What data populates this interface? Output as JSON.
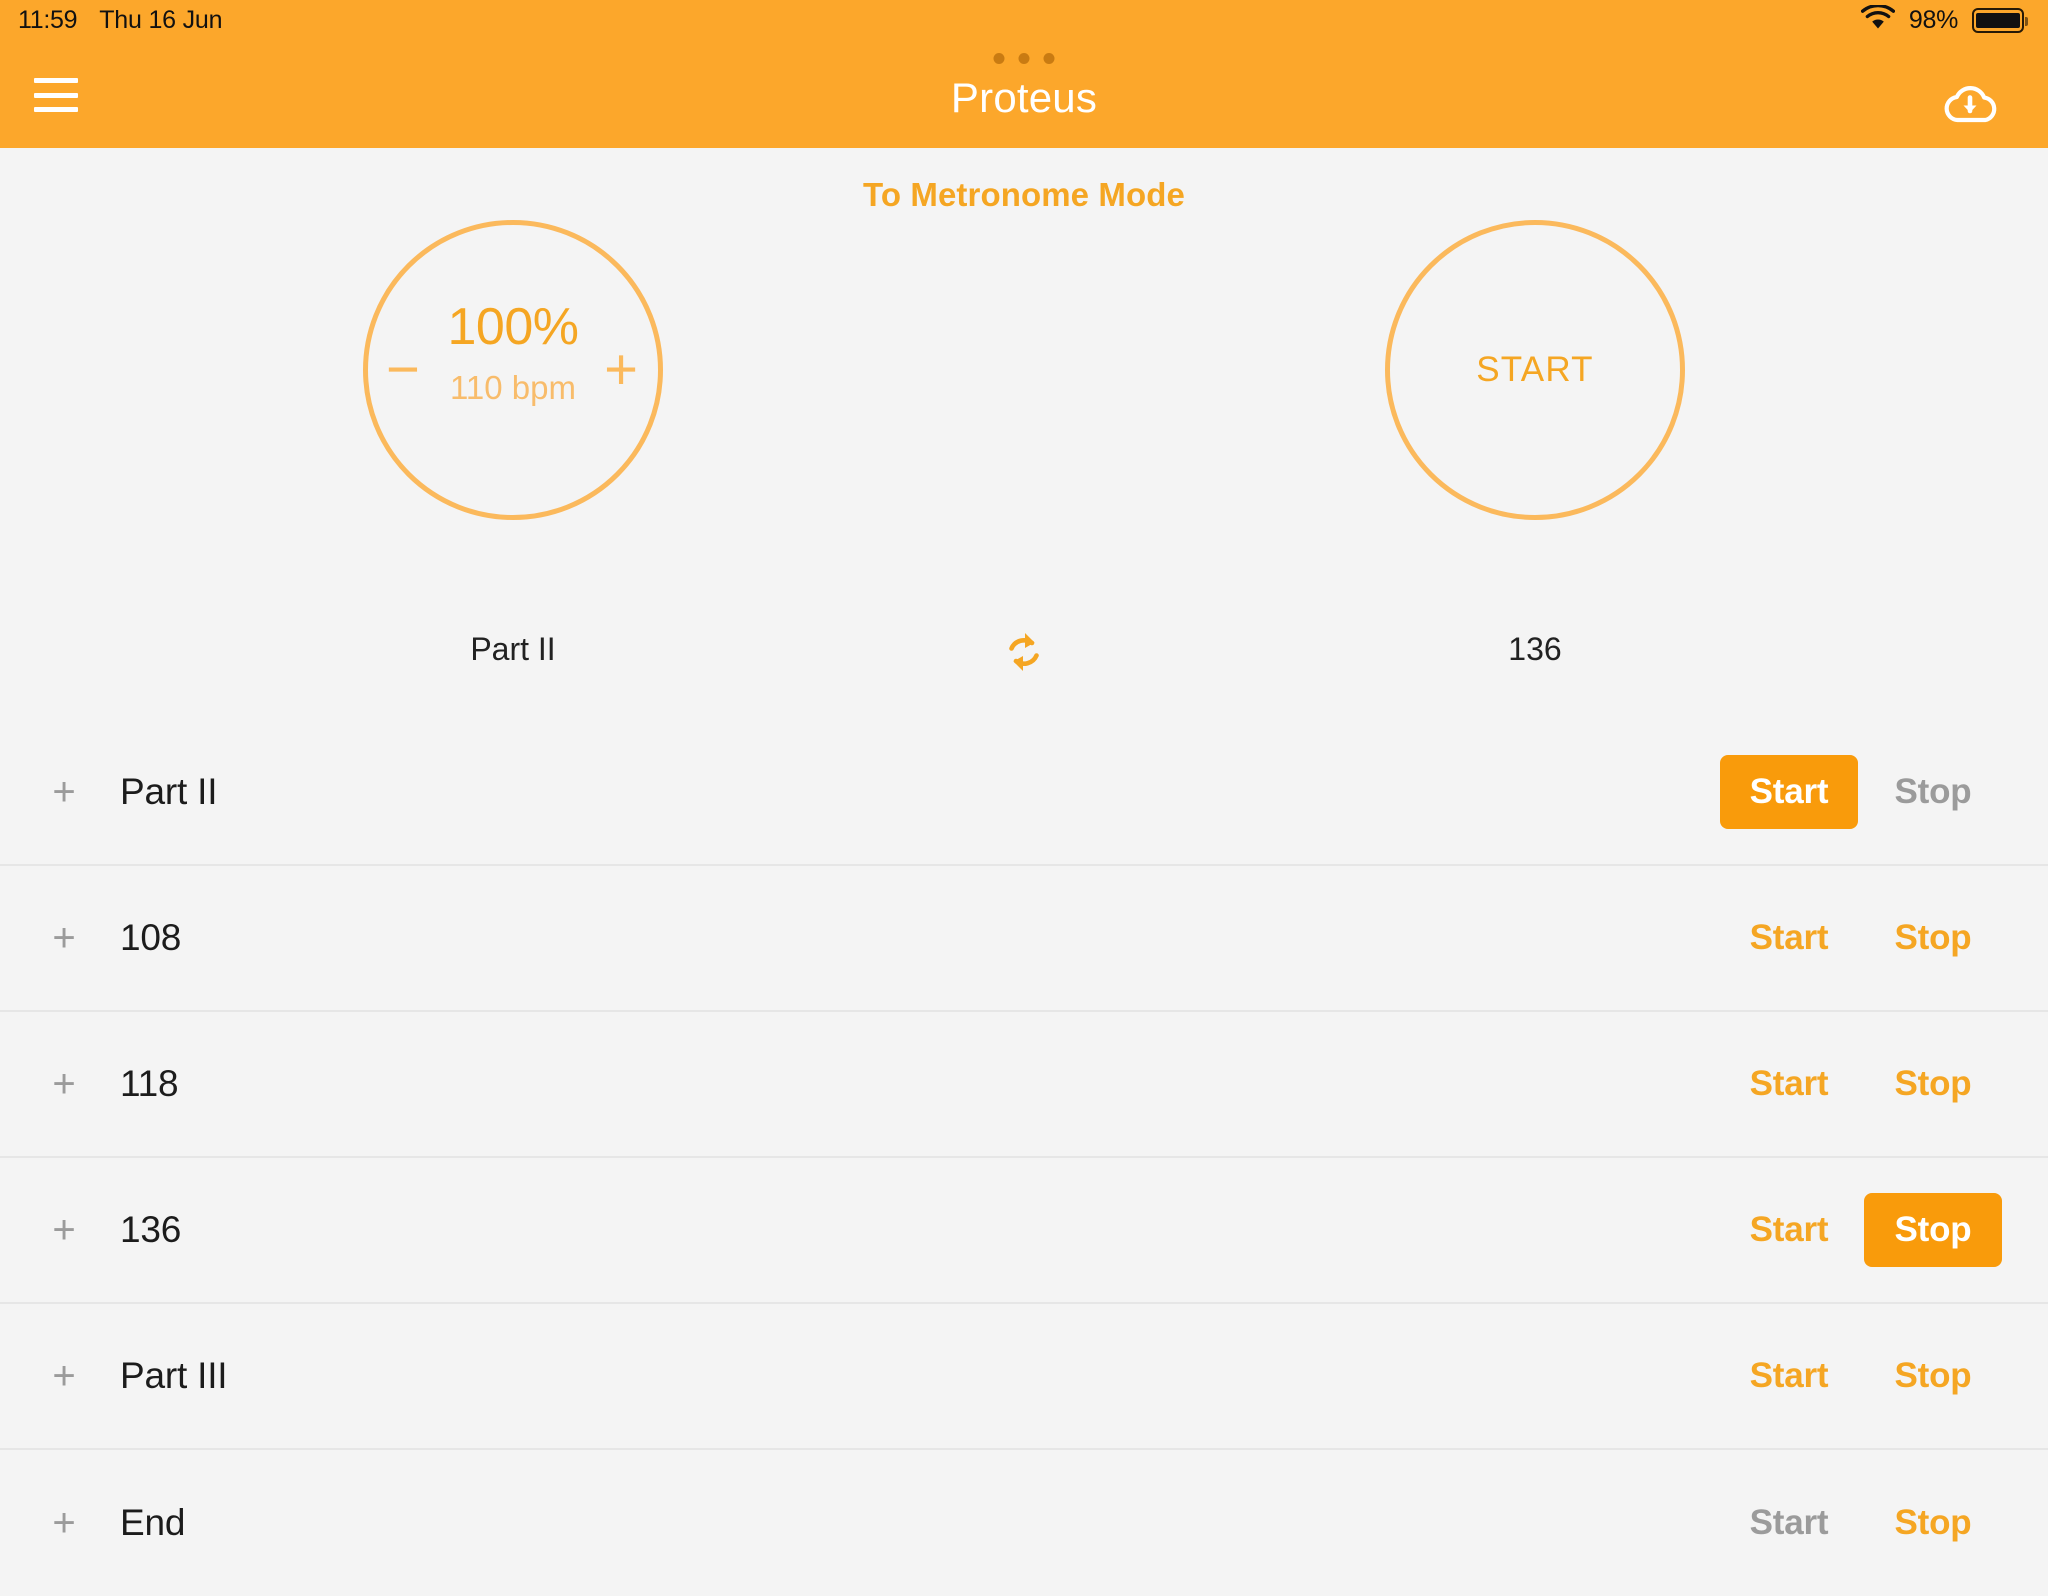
{
  "status_bar": {
    "time": "11:59",
    "date": "Thu 16 Jun",
    "battery_percent": "98%",
    "wifi_icon": "wifi-icon",
    "battery_icon": "battery-icon"
  },
  "nav_bar": {
    "menu_icon": "hamburger-menu-icon",
    "title": "Proteus",
    "cloud_icon": "cloud-download-icon",
    "multitask_handle": "multitask-dots"
  },
  "main": {
    "mode_link": "To Metronome Mode",
    "tempo_dial": {
      "minus_label": "−",
      "percent": "100%",
      "bpm": "110 bpm",
      "plus_label": "+",
      "caption": "Part II"
    },
    "sync_icon": "sync-repeat-icon",
    "start_dial": {
      "label": "START",
      "caption": "136"
    }
  },
  "colors": {
    "accent": "#F5A623",
    "nav_background": "#FCA72B",
    "button_filled": "#F99B0B",
    "dial_border": "#FBB95C",
    "disabled_text": "#9B9B9B",
    "page_background": "#F4F4F4"
  },
  "list": {
    "add_label": "+",
    "start_label": "Start",
    "stop_label": "Stop",
    "rows": [
      {
        "label": "Part II",
        "start_state": "active",
        "stop_state": "disabled"
      },
      {
        "label": "108",
        "start_state": "enabled",
        "stop_state": "enabled"
      },
      {
        "label": "118",
        "start_state": "enabled",
        "stop_state": "enabled"
      },
      {
        "label": "136",
        "start_state": "enabled",
        "stop_state": "active"
      },
      {
        "label": "Part III",
        "start_state": "enabled",
        "stop_state": "enabled"
      },
      {
        "label": "End",
        "start_state": "disabled",
        "stop_state": "enabled"
      }
    ]
  }
}
